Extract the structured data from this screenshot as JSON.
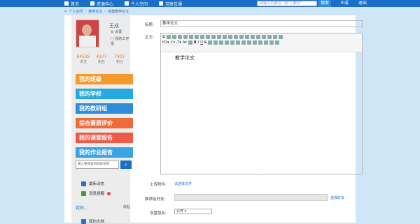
{
  "topbar": {
    "nav": [
      "首页",
      "资源中心",
      "个人空间",
      "互联互通"
    ],
    "search_placeholder": "请输入关键词，如\"三角形\"",
    "search_button": "搜索",
    "user": "王成",
    "logout": "退出"
  },
  "breadcrumb": [
    "个人空间",
    "教学论文",
    "创建教学论文"
  ],
  "profile": {
    "name": "王成",
    "menu": [
      "设置",
      "我的工作室"
    ],
    "stats": [
      {
        "num": "64535",
        "label": "关注"
      },
      {
        "num": "4377",
        "label": "粉丝"
      },
      {
        "num": "7407",
        "label": "积分"
      }
    ]
  },
  "left_menu": [
    {
      "label": "我的班级",
      "color": "#f29b2c"
    },
    {
      "label": "我的学校",
      "color": "#27a9e1"
    },
    {
      "label": "我的教研组",
      "color": "#2f8ed8"
    },
    {
      "label": "综合素质评价",
      "color": "#ef6b3a"
    },
    {
      "label": "我的课堂报告",
      "color": "#ef5a4a"
    },
    {
      "label": "我的作业报告",
      "color": "#3aa3e4"
    }
  ],
  "left_search": {
    "placeholder": "输入要搜索的班级名称"
  },
  "left_links": [
    "最新动态",
    "消息提醒"
  ],
  "left_more": {
    "label": "我的...",
    "action": "收起"
  },
  "left_bottom": "我的文档",
  "form": {
    "title_label": "标题:",
    "title_value": "教学论文",
    "body_label": "正文:",
    "body_text": "教学论文",
    "upload_label": "上传附件:",
    "upload_link": "请选择文件",
    "recommend_label": "推荐给好友:",
    "recommend_link": "选择好友",
    "privacy_label": "设置隐私:",
    "privacy_value": "公开"
  }
}
